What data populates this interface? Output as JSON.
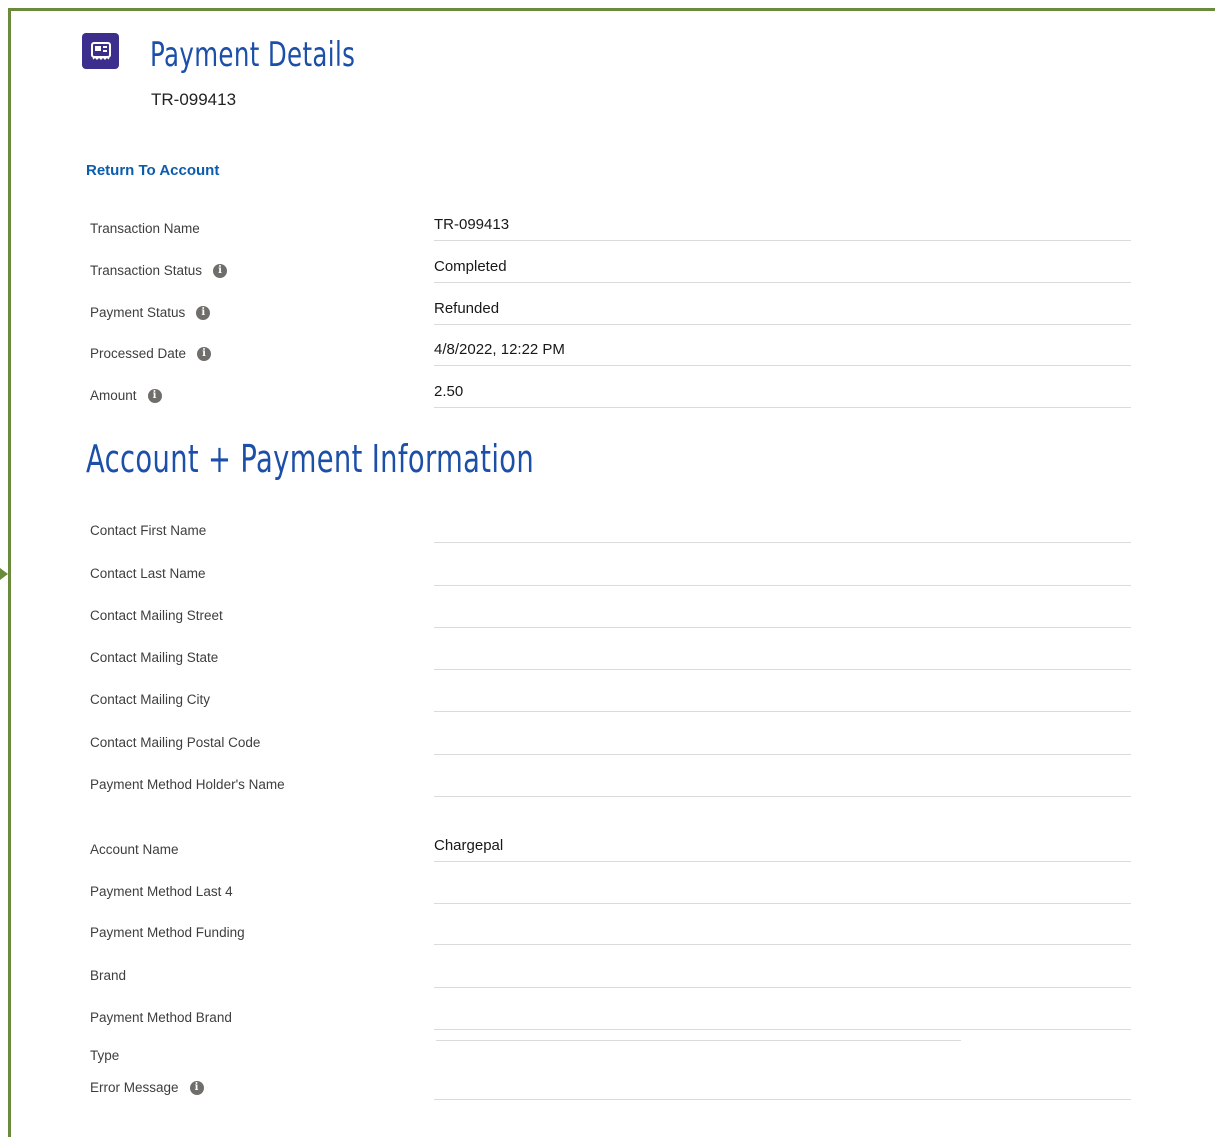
{
  "header": {
    "title": "Payment Details",
    "subtitle": "TR-099413",
    "icon": "receipt-icon",
    "icon_color": "#3b2e8c"
  },
  "nav": {
    "return_label": "Return To Account"
  },
  "details": [
    {
      "label": "Transaction Name",
      "value": "TR-099413",
      "info": false
    },
    {
      "label": "Transaction Status",
      "value": "Completed",
      "info": true
    },
    {
      "label": "Payment Status",
      "value": "Refunded",
      "info": true
    },
    {
      "label": "Processed Date",
      "value": "4/8/2022, 12:22 PM",
      "info": true
    },
    {
      "label": "Amount",
      "value": "2.50",
      "info": true
    }
  ],
  "section": {
    "title": "Account + Payment Information"
  },
  "account": [
    {
      "label": "Contact First Name",
      "value": ""
    },
    {
      "label": "Contact Last Name",
      "value": ""
    },
    {
      "label": "Contact Mailing Street",
      "value": ""
    },
    {
      "label": "Contact Mailing State",
      "value": ""
    },
    {
      "label": "Contact Mailing City",
      "value": ""
    },
    {
      "label": "Contact Mailing Postal Code",
      "value": ""
    },
    {
      "label": "Payment Method Holder's Name",
      "value": ""
    },
    {
      "label": "Account Name",
      "value": "Chargepal"
    },
    {
      "label": "Payment Method Last 4",
      "value": ""
    },
    {
      "label": "Payment Method Funding",
      "value": ""
    },
    {
      "label": "Brand",
      "value": ""
    },
    {
      "label": "Payment Method Brand",
      "value": ""
    }
  ],
  "type_label": "Type",
  "error": {
    "label": "Error Message",
    "value": ""
  },
  "colors": {
    "title": "#1c4fa8",
    "link": "#0b5cad",
    "frame": "#6b8a3c"
  }
}
